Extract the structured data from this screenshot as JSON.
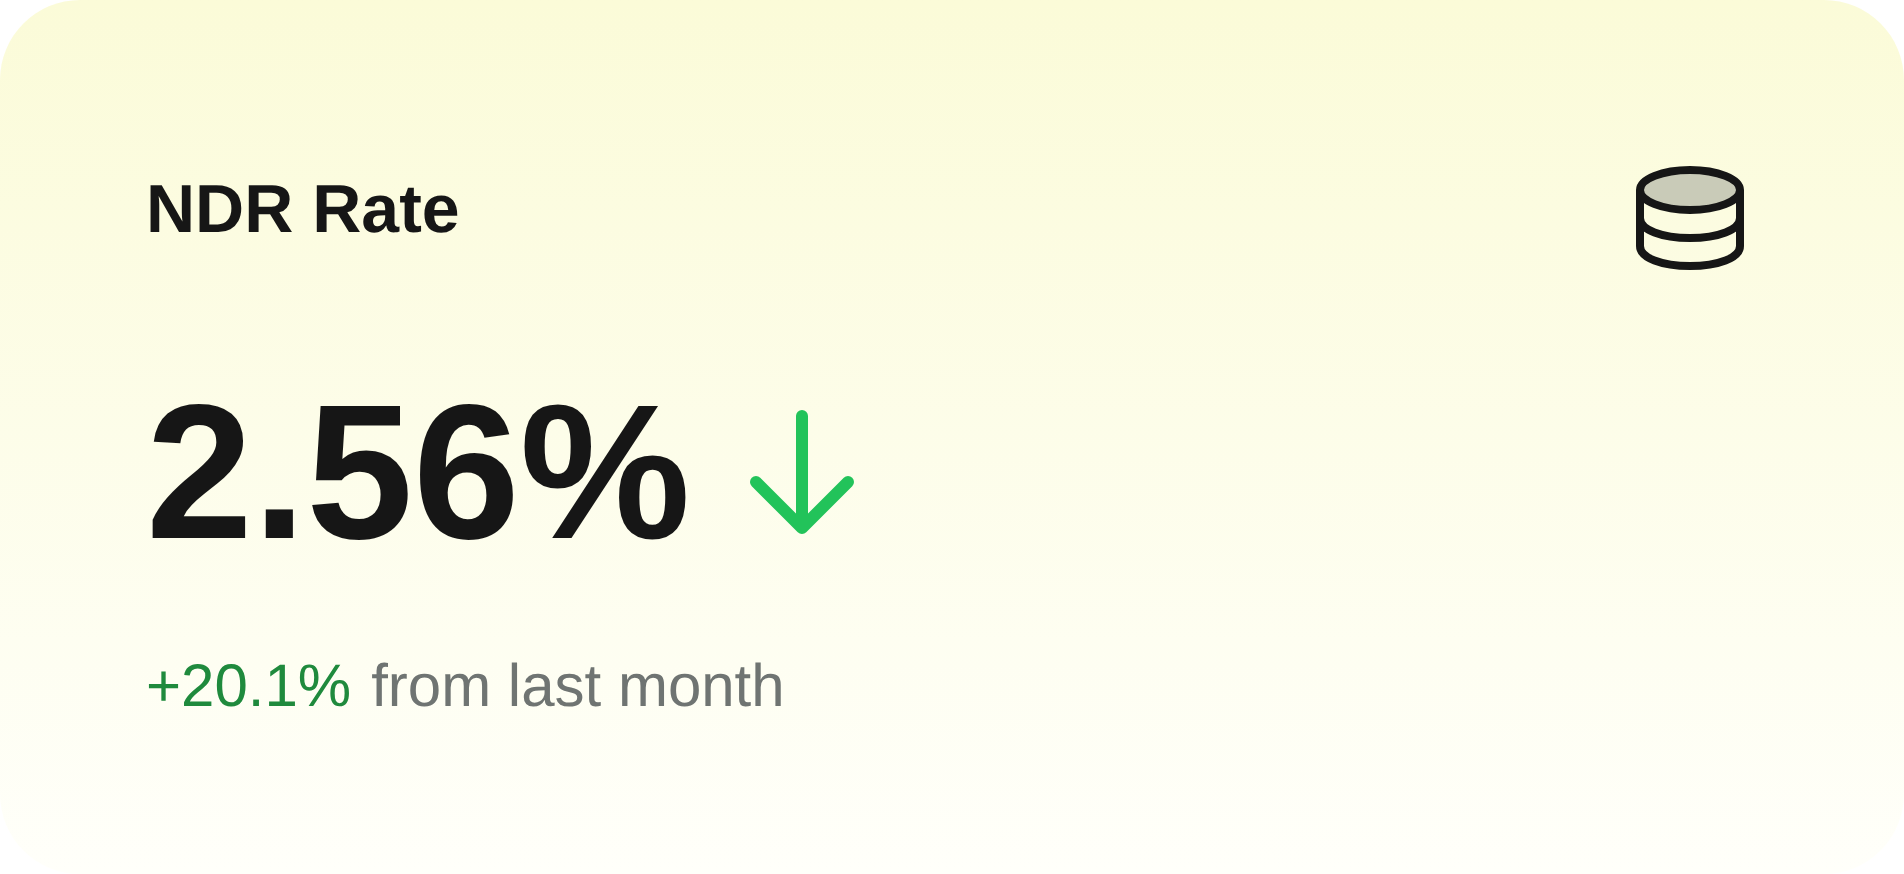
{
  "card": {
    "title": "NDR Rate",
    "value": "2.56%",
    "decreasing": true,
    "change": "+20.1%",
    "change_label": "from last month"
  }
}
